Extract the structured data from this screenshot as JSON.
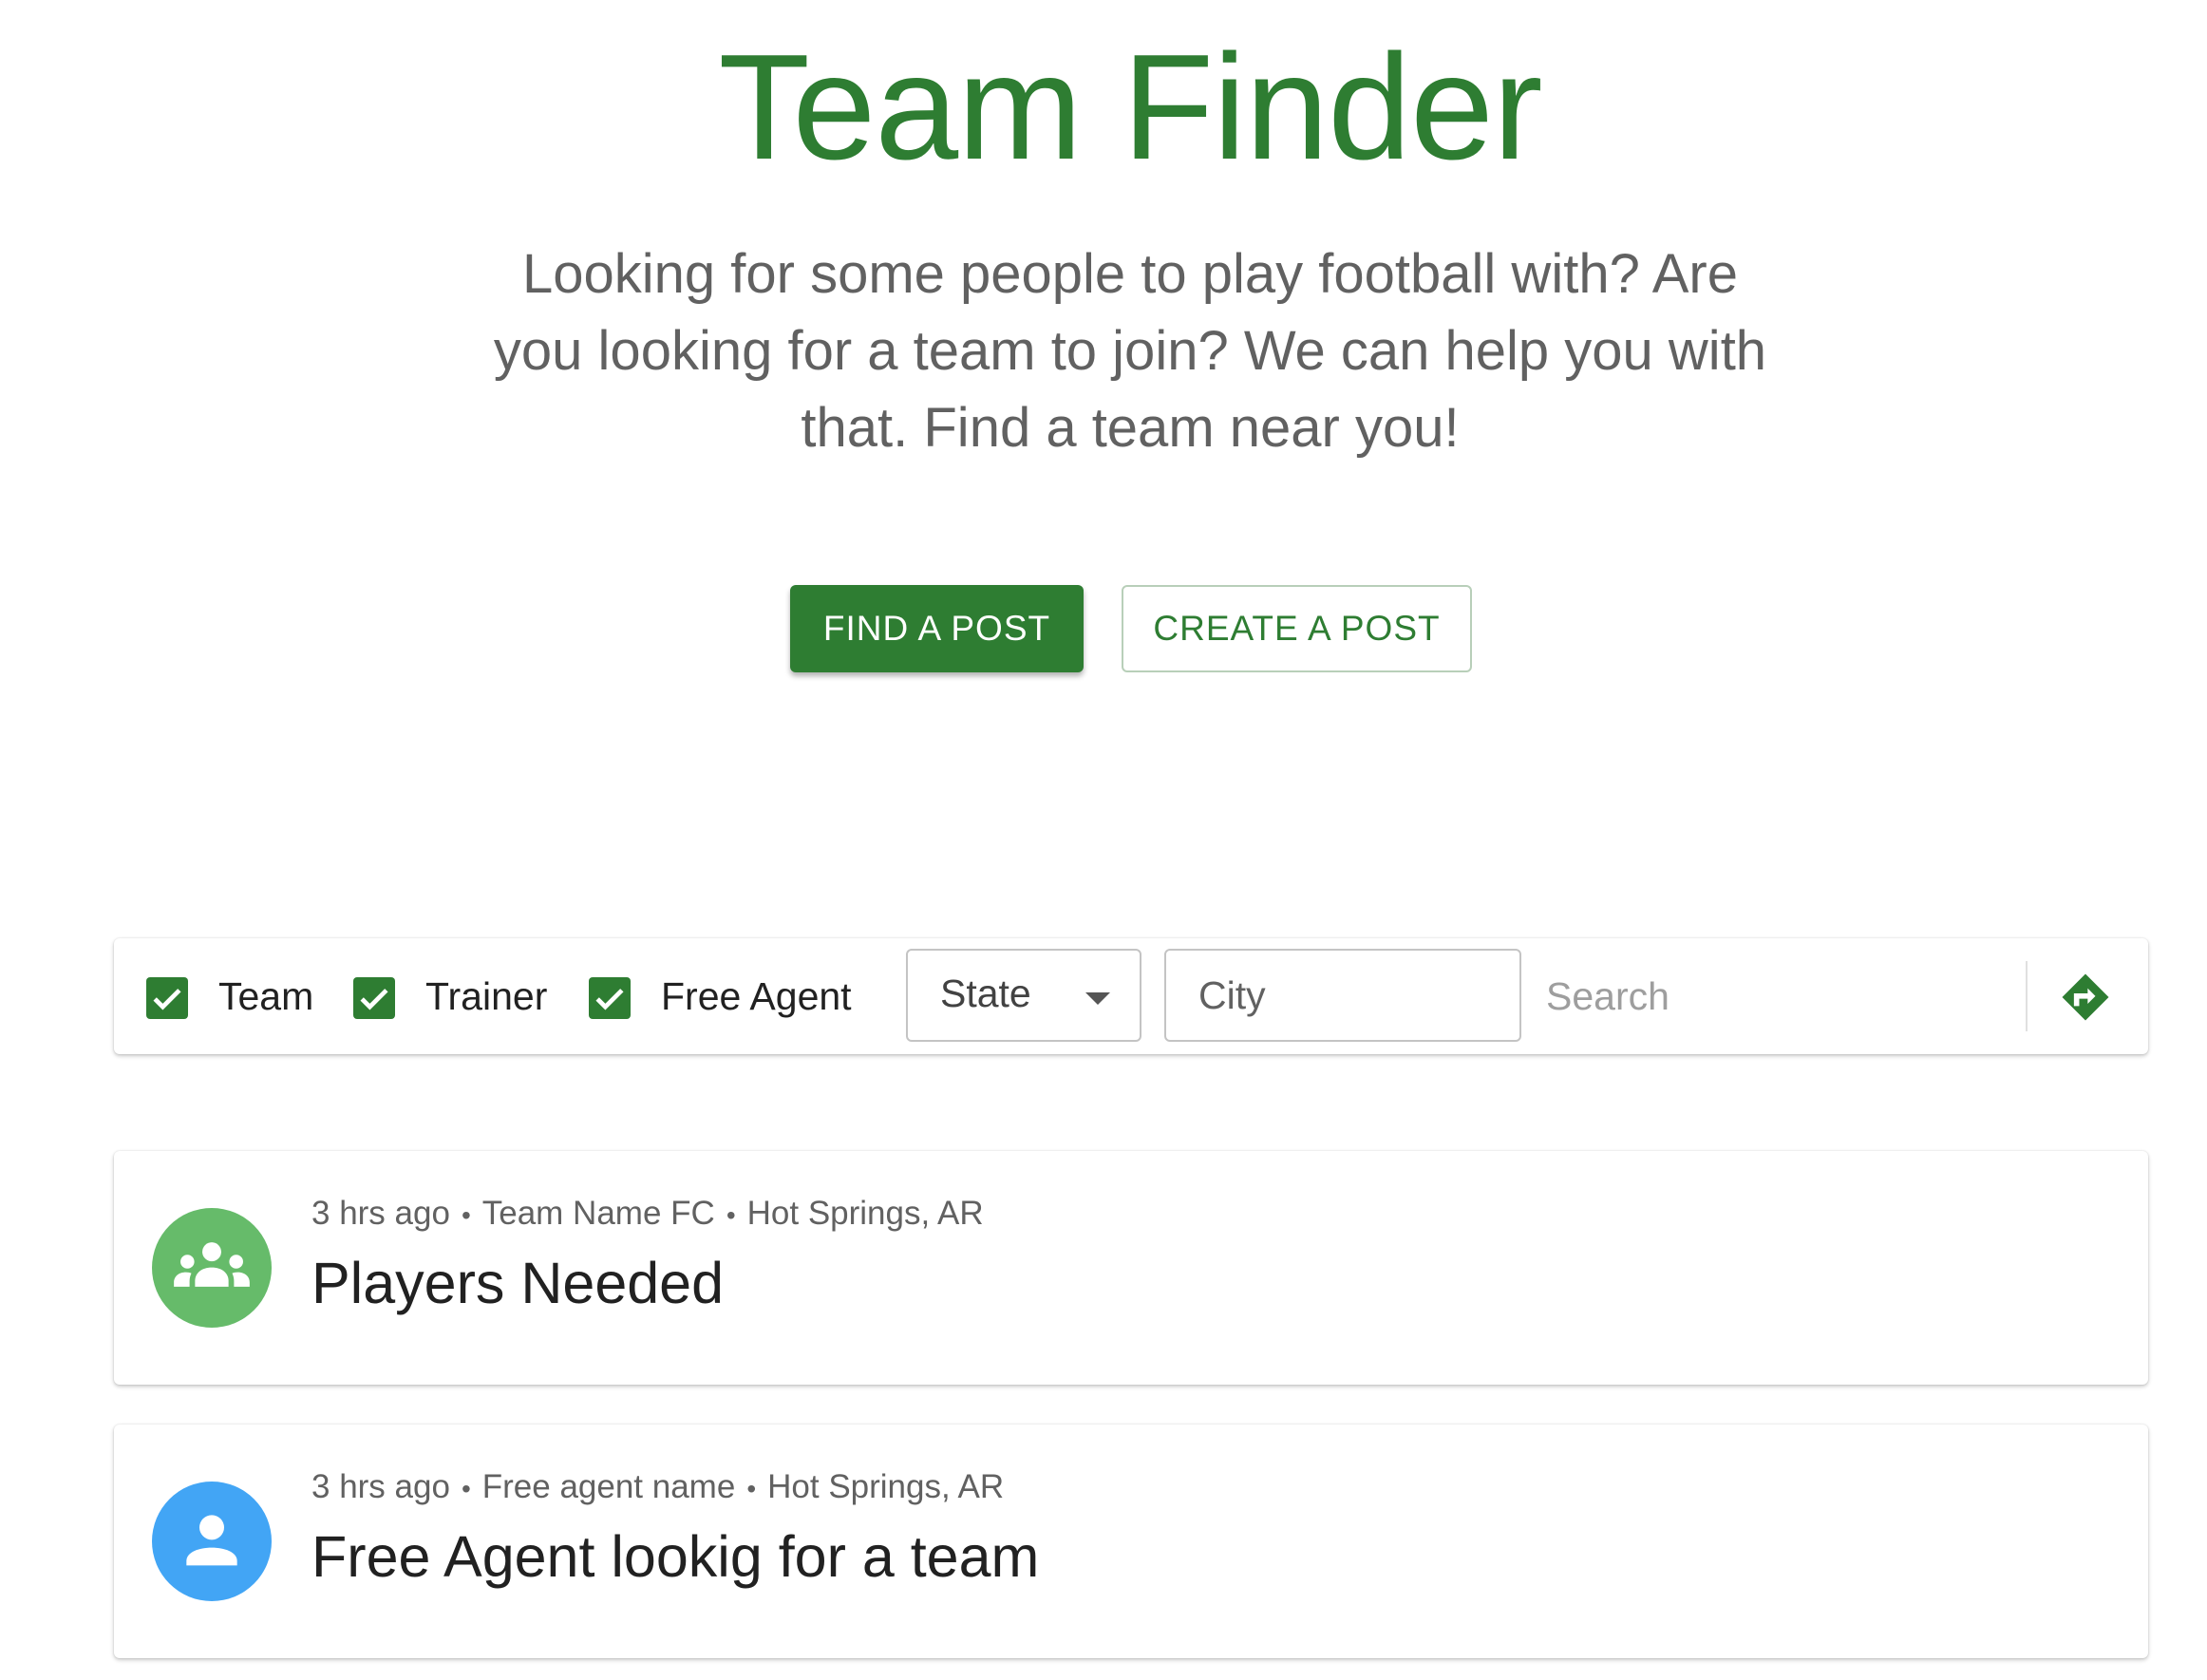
{
  "hero": {
    "title": "Team Finder",
    "subtitle": "Looking for some people to play football with? Are you looking for a team to join? We can help you with that. Find a team near you!",
    "find_label": "FIND A POST",
    "create_label": "CREATE A POST"
  },
  "filters": {
    "checkboxes": [
      {
        "label": "Team",
        "checked": true
      },
      {
        "label": "Trainer",
        "checked": true
      },
      {
        "label": "Free Agent",
        "checked": true
      }
    ],
    "state": {
      "value": "State"
    },
    "city": {
      "placeholder": "City"
    },
    "search": {
      "placeholder": "Search"
    },
    "submit_icon": "directions-icon"
  },
  "posts": [
    {
      "time": "3 hrs ago",
      "author": "Team Name FC",
      "location": "Hot Springs, AR",
      "title": "Players Needed",
      "icon": "groups-icon",
      "avatar_color": "#66bb6a"
    },
    {
      "time": "3 hrs ago",
      "author": "Free agent name",
      "location": "Hot Springs, AR",
      "title": "Free Agent lookig for a team",
      "icon": "person-icon",
      "avatar_color": "#42a5f5"
    }
  ],
  "separator": "•",
  "colors": {
    "primary": "#2e7d32",
    "text_secondary": "#616161"
  }
}
